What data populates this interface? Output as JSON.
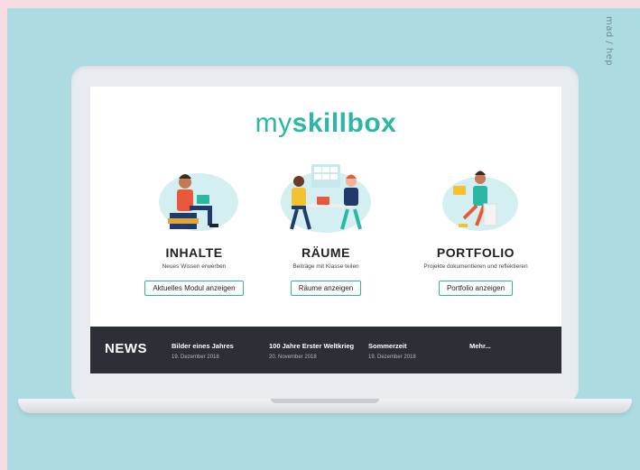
{
  "credit": "mad / hep",
  "app": {
    "logo_light": "my",
    "logo_bold": "skillbox"
  },
  "cards": [
    {
      "title": "INHALTE",
      "subtitle": "Neues Wissen erwerben",
      "button": "Aktuelles Modul anzeigen"
    },
    {
      "title": "RÄUME",
      "subtitle": "Beiträge mit Klasse teilen",
      "button": "Räume anzeigen"
    },
    {
      "title": "PORTFOLIO",
      "subtitle": "Projekte dokumentieren und reflektieren",
      "button": "Portfolio anzeigen"
    }
  ],
  "news": {
    "label": "NEWS",
    "items": [
      {
        "title": "Bilder eines Jahres",
        "date": "19. Dezember 2018"
      },
      {
        "title": "100 Jahre Erster Weltkrieg",
        "date": "20. November 2018"
      },
      {
        "title": "Sommerzeit",
        "date": "19. Dezember 2018"
      }
    ],
    "more": "Mehr..."
  },
  "colors": {
    "accent": "#2ab8a4",
    "newsbar": "#2d2f36",
    "frame_teal": "#acdbe1",
    "frame_pink": "#f7dde2"
  }
}
